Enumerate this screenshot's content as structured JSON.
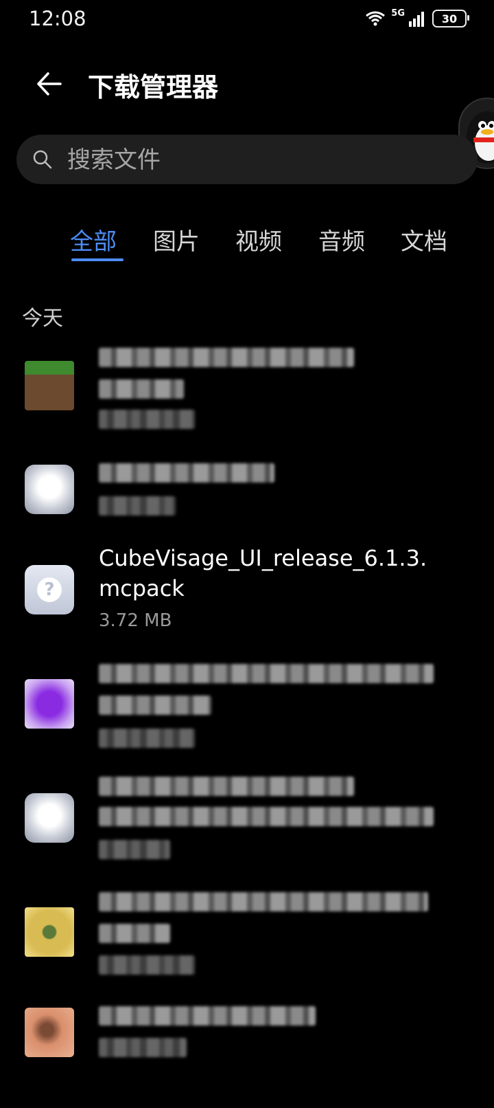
{
  "status_bar": {
    "time": "12:08",
    "network": "5G",
    "battery": "30"
  },
  "header": {
    "title": "下载管理器"
  },
  "search": {
    "placeholder": "搜索文件"
  },
  "tabs": [
    {
      "label": "全部",
      "active": true
    },
    {
      "label": "图片",
      "active": false
    },
    {
      "label": "视频",
      "active": false
    },
    {
      "label": "音频",
      "active": false
    },
    {
      "label": "文档",
      "active": false
    }
  ],
  "section": {
    "today": "今天"
  },
  "files": [
    {
      "name_line1": "CubeVisage_UI_release_6.1.3.",
      "name_line2": "mcpack",
      "size": "3.72 MB",
      "icon": "unknown-file-icon"
    }
  ],
  "colors": {
    "accent": "#4d8df7",
    "background": "#000000",
    "search_bg": "#1f1f1f"
  }
}
